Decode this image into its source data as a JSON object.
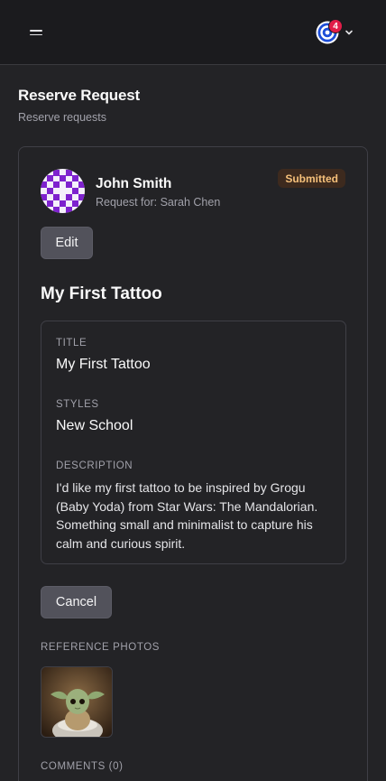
{
  "header": {
    "menu_icon": "hamburger-icon",
    "notification_count": "4",
    "user_menu_icon": "chevron-down-icon"
  },
  "page": {
    "title": "Reserve Request",
    "subtitle": "Reserve requests"
  },
  "request": {
    "user_name": "John Smith",
    "request_for": "Request for: Sarah Chen",
    "status": "Submitted",
    "edit_label": "Edit",
    "heading": "My First Tattoo",
    "fields": {
      "title_label": "TITLE",
      "title_value": "My First Tattoo",
      "styles_label": "STYLES",
      "styles_value": "New School",
      "description_label": "DESCRIPTION",
      "description_value": "I'd like my first tattoo to be inspired by Grogu (Baby Yoda) from Star Wars: The Mandalorian. Something small and minimalist to capture his calm and curious spirit."
    },
    "cancel_label": "Cancel",
    "reference_photos_label": "REFERENCE PHOTOS",
    "comments_label": "COMMENTS (0)"
  },
  "colors": {
    "background": "#232326",
    "header": "#1b1b1e",
    "badge_bg": "#3d2a1e",
    "badge_text": "#f5c07a",
    "notification": "#e11d48",
    "button": "#52525b",
    "avatar_accent": "#7e22ce"
  }
}
